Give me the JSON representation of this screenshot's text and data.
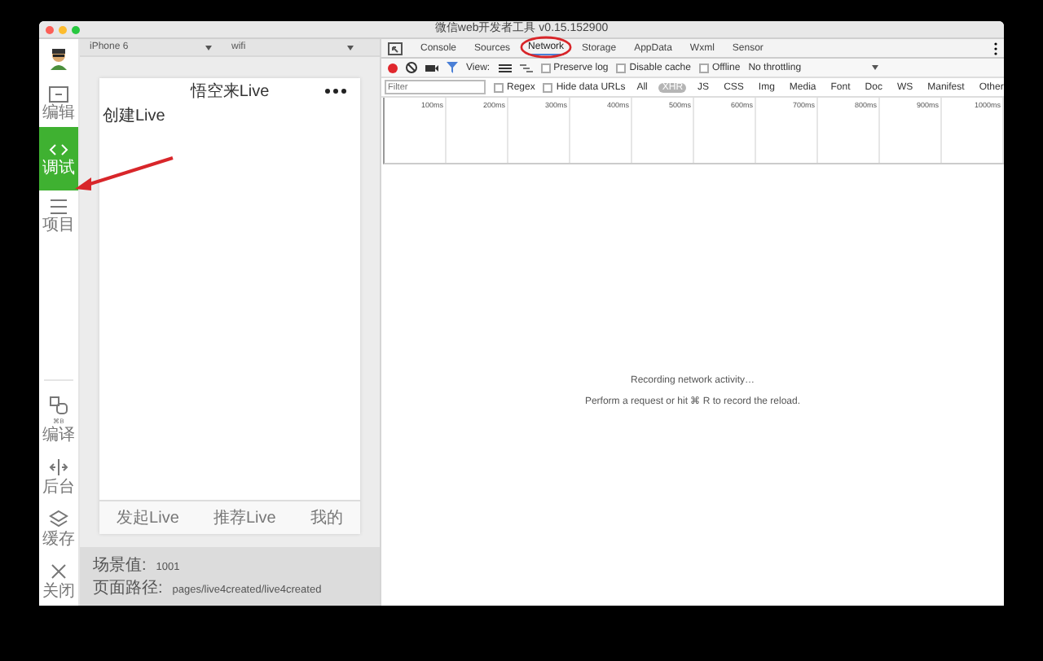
{
  "window": {
    "title": "微信web开发者工具 v0.15.152900"
  },
  "sidebar": {
    "top_items": [
      {
        "label": "编辑",
        "kind": "edit",
        "selected": false
      },
      {
        "label": "调试",
        "kind": "debug",
        "selected": true
      },
      {
        "label": "项目",
        "kind": "project",
        "selected": false
      }
    ],
    "bottom_items": [
      {
        "label": "编译",
        "kind": "compile",
        "shortcut": "⌘B"
      },
      {
        "label": "后台",
        "kind": "background"
      },
      {
        "label": "缓存",
        "kind": "cache"
      },
      {
        "label": "关闭",
        "kind": "close"
      }
    ]
  },
  "device_bar": {
    "device": "iPhone 6",
    "network": "wifi"
  },
  "phone": {
    "title": "悟空来Live",
    "heading": "创建Live",
    "tabs": [
      "发起Live",
      "推荐Live",
      "我的"
    ]
  },
  "info": [
    {
      "label": "场景值:",
      "value": "1001"
    },
    {
      "label": "页面路径:",
      "value": "pages/live4created/live4created"
    }
  ],
  "devtools": {
    "tabs": [
      {
        "label": "Console",
        "selected": false
      },
      {
        "label": "Sources",
        "selected": false
      },
      {
        "label": "Network",
        "selected": true
      },
      {
        "label": "Storage",
        "selected": false
      },
      {
        "label": "AppData",
        "selected": false
      },
      {
        "label": "Wxml",
        "selected": false
      },
      {
        "label": "Sensor",
        "selected": false
      }
    ],
    "recording": true,
    "view_label": "View:",
    "options": [
      {
        "label": "Preserve log",
        "checked": false
      },
      {
        "label": "Disable cache",
        "checked": false
      },
      {
        "label": "Offline",
        "checked": false
      }
    ],
    "throttling": "No throttling",
    "filter": {
      "placeholder": "Filter"
    },
    "filter_options": [
      {
        "label": "Regex",
        "checked": false
      },
      {
        "label": "Hide data URLs",
        "checked": false
      }
    ],
    "types": [
      {
        "label": "All",
        "selected": false
      },
      {
        "label": "XHR",
        "selected": true
      },
      {
        "label": "JS",
        "selected": false
      },
      {
        "label": "CSS",
        "selected": false
      },
      {
        "label": "Img",
        "selected": false
      },
      {
        "label": "Media",
        "selected": false
      },
      {
        "label": "Font",
        "selected": false
      },
      {
        "label": "Doc",
        "selected": false
      },
      {
        "label": "WS",
        "selected": false
      },
      {
        "label": "Manifest",
        "selected": false
      },
      {
        "label": "Other",
        "selected": false
      }
    ],
    "ticks": [
      "100ms",
      "200ms",
      "300ms",
      "400ms",
      "500ms",
      "600ms",
      "700ms",
      "800ms",
      "900ms",
      "1000ms"
    ],
    "messages": [
      "Recording network activity…",
      "Perform a request or hit ⌘ R to record the reload."
    ]
  }
}
